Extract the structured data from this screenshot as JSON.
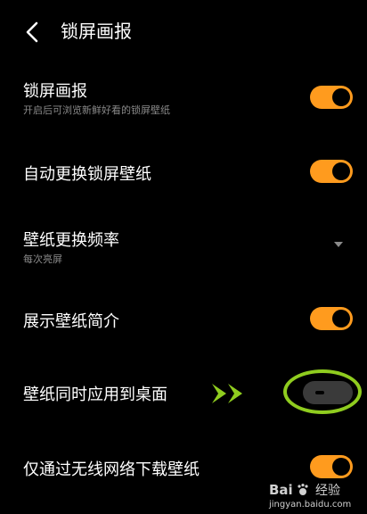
{
  "header": {
    "title": "锁屏画报"
  },
  "settings": {
    "lock_screen_magazine": {
      "label": "锁屏画报",
      "subtitle": "开启后可浏览新鲜好看的锁屏壁纸",
      "enabled": true
    },
    "auto_change_wallpaper": {
      "label": "自动更换锁屏壁纸",
      "enabled": true
    },
    "change_frequency": {
      "label": "壁纸更换频率",
      "value": "每次亮屏"
    },
    "show_intro": {
      "label": "展示壁纸简介",
      "enabled": true
    },
    "apply_to_desktop": {
      "label": "壁纸同时应用到桌面",
      "enabled": false
    },
    "wifi_only_download": {
      "label": "仅通过无线网络下载壁纸",
      "enabled": true
    }
  },
  "watermark": {
    "brand": "Bai",
    "brand2": "经验",
    "url": "jingyan.baidu.com"
  },
  "colors": {
    "accent": "#ff9b1e",
    "annotation": "#8fcc1f",
    "toggle_off": "#3a3a3a"
  }
}
